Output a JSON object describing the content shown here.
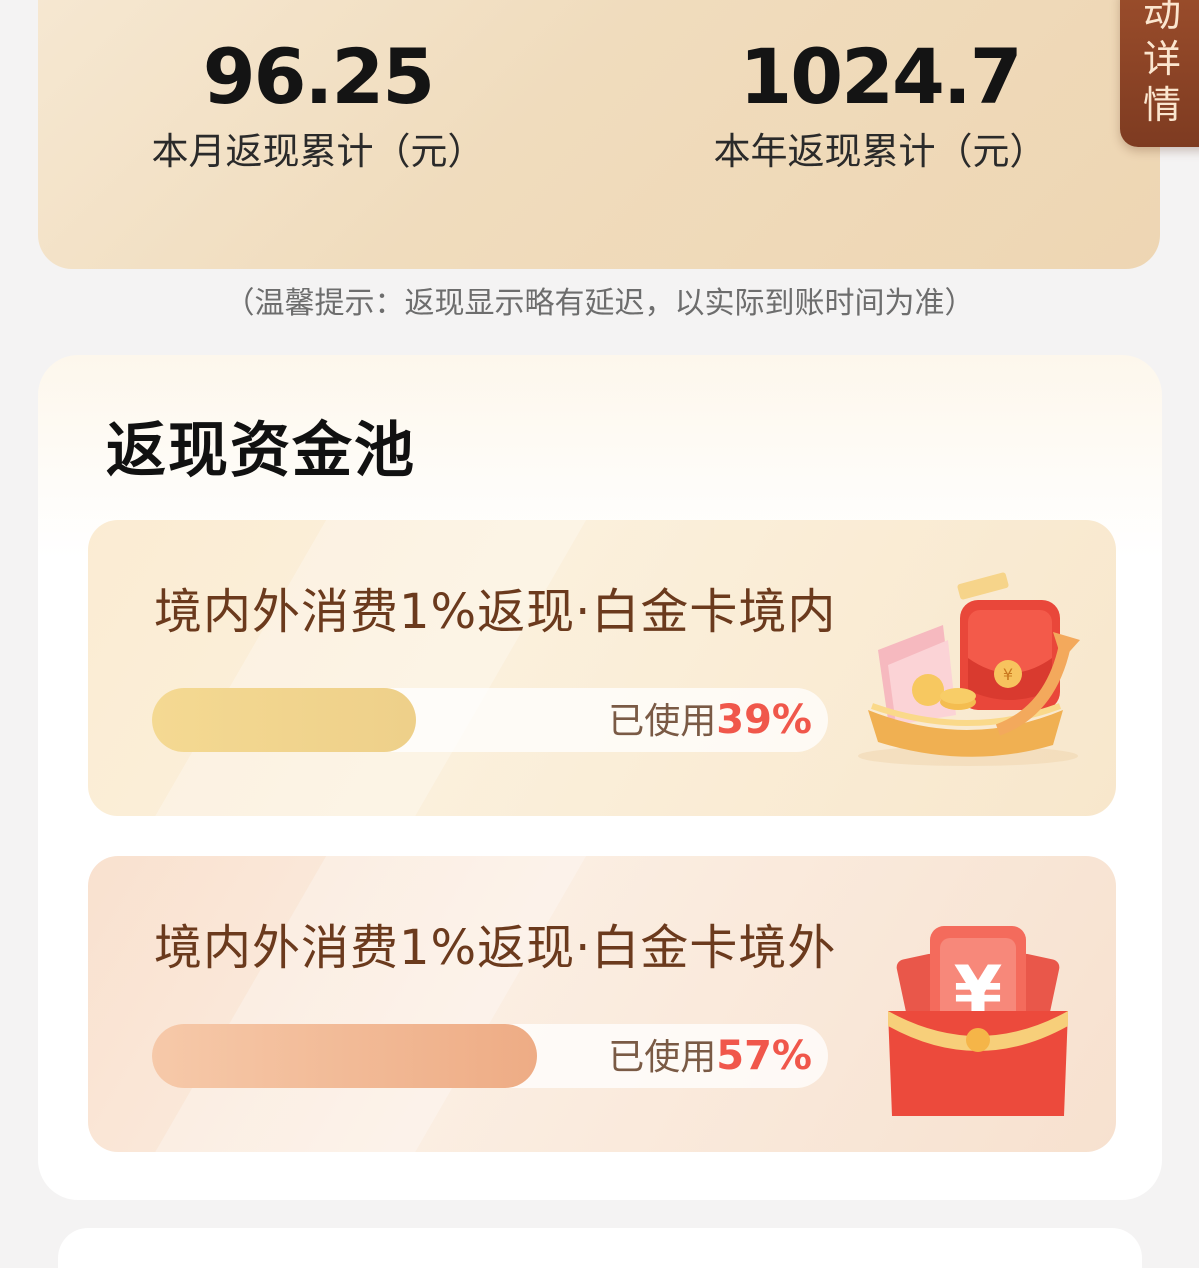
{
  "summary": {
    "monthly": {
      "value": "96.25",
      "label": "本月返现累计（元）"
    },
    "yearly": {
      "value": "1024.7",
      "label": "本年返现累计（元）"
    },
    "side_tab": "动\n详\n情"
  },
  "tip": "（温馨提示：返现显示略有延迟，以实际到账时间为准）",
  "pool": {
    "title": "返现资金池",
    "items": [
      {
        "title": "境内外消费1%返现·白金卡境内",
        "used_label": "已使用",
        "used_percent": "39%",
        "used_fraction": 0.39,
        "icon": "wallet-money-icon"
      },
      {
        "title": "境内外消费1%返现·白金卡境外",
        "used_label": "已使用",
        "used_percent": "57%",
        "used_fraction": 0.57,
        "icon": "red-envelope-yuan-icon"
      }
    ]
  },
  "colors": {
    "accent_red": "#f0574b",
    "brown_text": "#6b3a1d",
    "tab_brown": "#8a4427"
  }
}
